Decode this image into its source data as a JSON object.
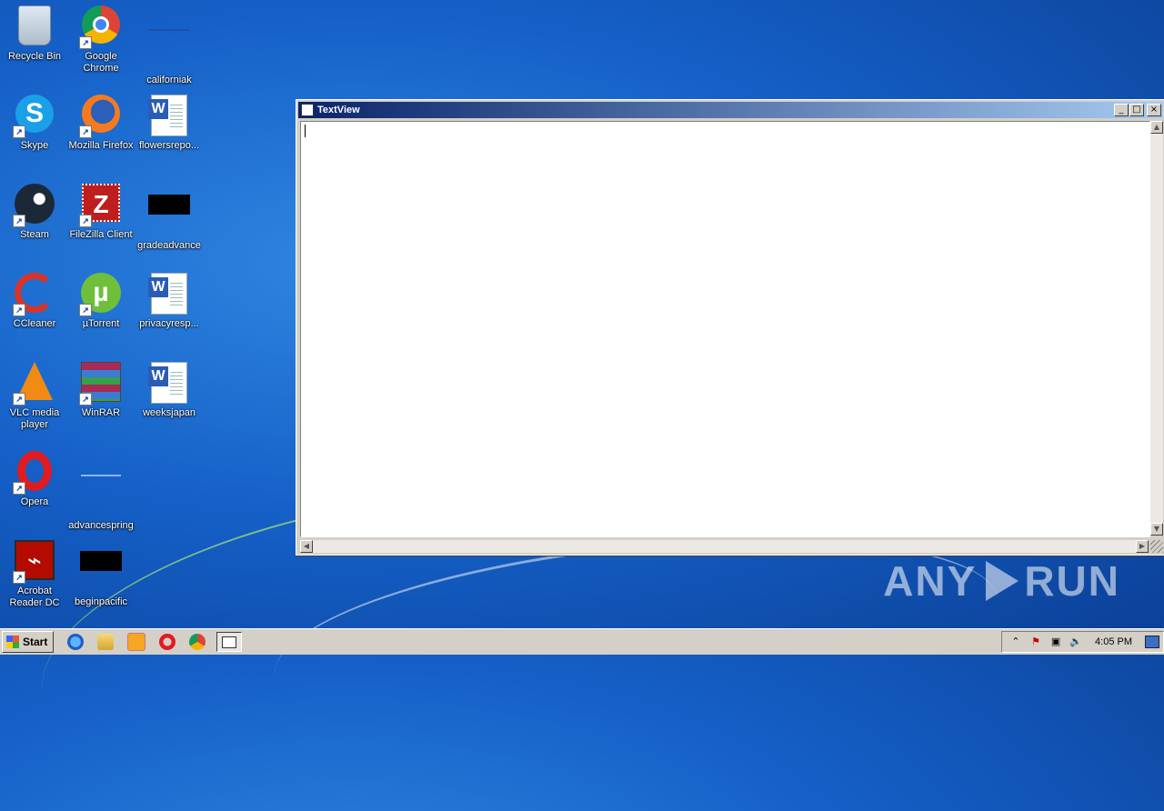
{
  "desktop": {
    "icons": [
      {
        "label": "Recycle Bin"
      },
      {
        "label": "Google Chrome"
      },
      {
        "label": "californiak"
      },
      {
        "label": "Skype"
      },
      {
        "label": "Mozilla Firefox"
      },
      {
        "label": "flowersrepo..."
      },
      {
        "label": "Steam"
      },
      {
        "label": "FileZilla Client"
      },
      {
        "label": "gradeadvance"
      },
      {
        "label": "CCleaner"
      },
      {
        "label": "µTorrent"
      },
      {
        "label": "privacyresp..."
      },
      {
        "label": "VLC media player"
      },
      {
        "label": "WinRAR"
      },
      {
        "label": "weeksjapan"
      },
      {
        "label": "Opera"
      },
      {
        "label": "advancespring"
      },
      {
        "label": "Acrobat Reader DC"
      },
      {
        "label": "beginpacific"
      }
    ]
  },
  "window": {
    "title": "TextView",
    "minimize": "_",
    "maximize": "□",
    "close": "×",
    "content": ""
  },
  "watermark": {
    "left": "ANY",
    "right": "RUN"
  },
  "taskbar": {
    "start_label": "Start",
    "clock": "4:05 PM"
  }
}
